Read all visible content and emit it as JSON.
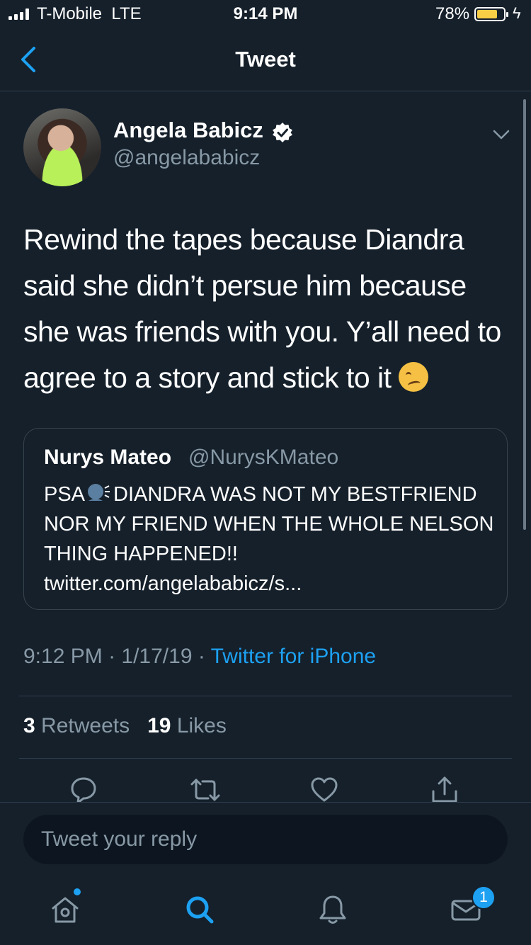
{
  "status_bar": {
    "carrier": "T-Mobile",
    "network": "LTE",
    "time": "9:14 PM",
    "battery": "78%",
    "battery_level": 0.78
  },
  "nav": {
    "title": "Tweet"
  },
  "tweet": {
    "author_name": "Angela Babicz",
    "handle": "@angelababicz",
    "text": "Rewind the tapes because Diandra said she didn’t persue him because she was friends with you. Y’all need to agree to a story and stick to it",
    "quote": {
      "name": "Nurys Mateo",
      "handle": "@NurysKMateo",
      "text_prefix": "PSA",
      "text": "DIANDRA WAS NOT MY BESTFRIEND NOR MY FRIEND WHEN THE WHOLE NELSON THING HAPPENED!!",
      "link": "twitter.com/angelababicz/s..."
    },
    "time": "9:12 PM",
    "date": "1/17/19",
    "source": "Twitter for iPhone",
    "retweets_count": "3",
    "retweets_label": "Retweets",
    "likes_count": "19",
    "likes_label": "Likes"
  },
  "reply": {
    "placeholder": "Tweet your reply"
  },
  "tabbar": {
    "notification_badge": "1"
  },
  "colors": {
    "background": "#15202b",
    "accent": "#1da1f2",
    "muted": "#8899a6",
    "divider": "#2f3d4d"
  }
}
